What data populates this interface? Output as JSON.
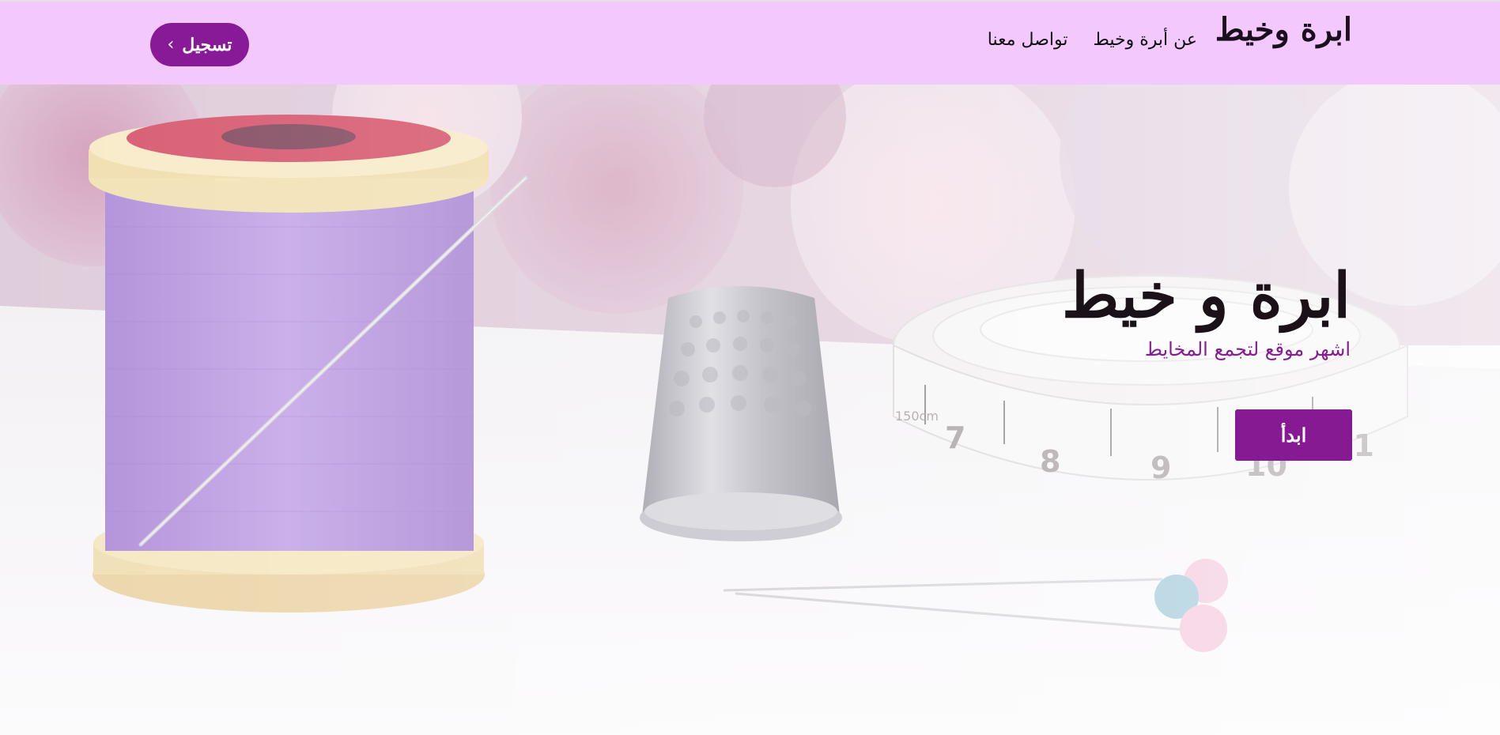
{
  "navbar": {
    "brand": "ابرة وخيط",
    "links": [
      {
        "label": "عن أبرة وخيط"
      },
      {
        "label": "تواصل معنا"
      }
    ],
    "signup_label": "تسجيل",
    "signup_icon": "chevron-right-icon",
    "background_color": "#f3c9fd",
    "accent_color": "#881a97"
  },
  "hero": {
    "title": "ابرة و خيط",
    "subtitle": "اشهر موقع لتجمع المخايط",
    "start_label": "ابدأ",
    "tape_numbers": [
      "7",
      "8",
      "9",
      "10",
      "11"
    ],
    "tape_unit_label": "150cm"
  }
}
